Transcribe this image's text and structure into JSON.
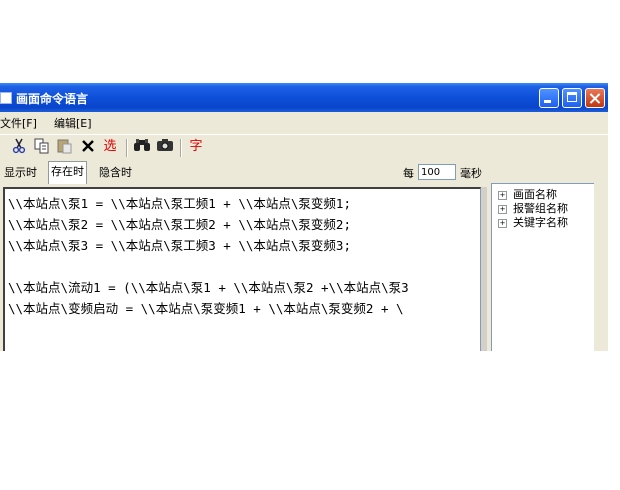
{
  "window": {
    "title": "画面命令语言"
  },
  "menu": {
    "items": [
      "文件[F]",
      "编辑[E]"
    ]
  },
  "toolbar": {
    "cut_icon": "scissors-icon",
    "copy_icon": "copy-icon",
    "paste_icon": "paste-icon",
    "delete_icon": "delete-x-icon",
    "select_label": "选",
    "find_icon": "binoculars-icon",
    "replace_icon": "camera-icon",
    "font_label": "字"
  },
  "tabs": [
    "显示时",
    "存在时",
    "隐含时"
  ],
  "active_tab": "存在时",
  "interval": {
    "prefix": "每",
    "value": "100",
    "unit": "毫秒"
  },
  "code_lines": [
    "\\\\本站点\\泵1 = \\\\本站点\\泵工频1 + \\\\本站点\\泵变频1;",
    "\\\\本站点\\泵2 = \\\\本站点\\泵工频2 + \\\\本站点\\泵变频2;",
    "\\\\本站点\\泵3 = \\\\本站点\\泵工频3 + \\\\本站点\\泵变频3;",
    "",
    "\\\\本站点\\流动1 = (\\\\本站点\\泵1 + \\\\本站点\\泵2 +\\\\本站点\\泵3",
    "\\\\本站点\\变频启动 = \\\\本站点\\泵变频1 + \\\\本站点\\泵变频2 + \\"
  ],
  "tree": {
    "items": [
      "画面名称",
      "报警组名称",
      "关键字名称"
    ]
  },
  "colors": {
    "titlebar": "#0a45cc",
    "window_bg": "#ece9d8",
    "accent_red": "#e00000"
  }
}
